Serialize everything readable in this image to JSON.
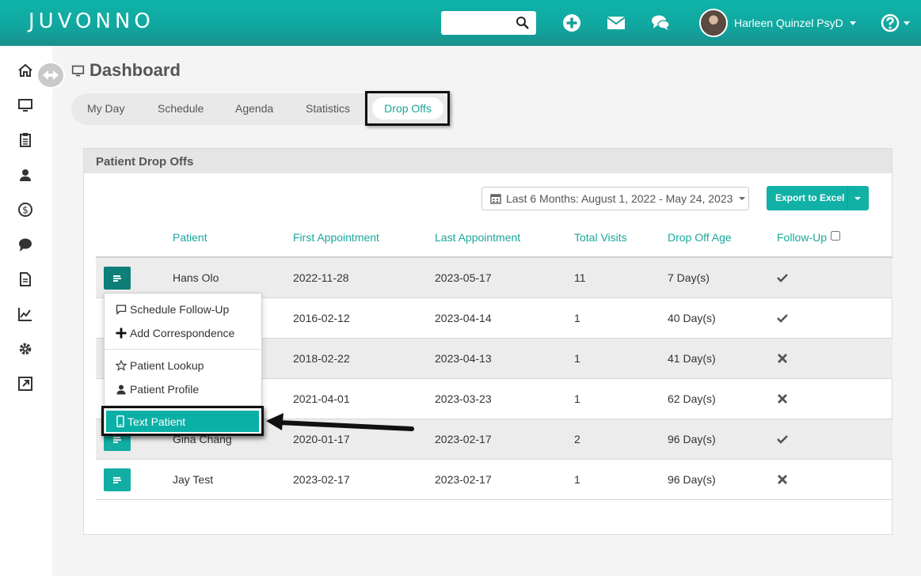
{
  "app": {
    "logo": "JUVONNO"
  },
  "header": {
    "search_placeholder": "",
    "user_name": "Harleen Quinzel PsyD"
  },
  "page": {
    "title": "Dashboard"
  },
  "tabs": [
    {
      "label": "My Day"
    },
    {
      "label": "Schedule"
    },
    {
      "label": "Agenda"
    },
    {
      "label": "Statistics"
    },
    {
      "label": "Drop Offs",
      "active": true
    }
  ],
  "panel": {
    "title": "Patient Drop Offs",
    "date_range": "Last 6 Months: August 1, 2022 - May 24, 2023",
    "export_label": "Export to Excel"
  },
  "table": {
    "columns": [
      "Patient",
      "First Appointment",
      "Last Appointment",
      "Total Visits",
      "Drop Off Age",
      "Follow-Up"
    ],
    "rows": [
      {
        "patient": "Hans Olo",
        "first": "2022-11-28",
        "last": "2023-05-17",
        "visits": "11",
        "age": "7 Day(s)",
        "follow_up": "check"
      },
      {
        "patient": "",
        "first": "2016-02-12",
        "last": "2023-04-14",
        "visits": "1",
        "age": "40 Day(s)",
        "follow_up": "check"
      },
      {
        "patient": "",
        "first": "2018-02-22",
        "last": "2023-04-13",
        "visits": "1",
        "age": "41 Day(s)",
        "follow_up": "x"
      },
      {
        "patient": "",
        "first": "2021-04-01",
        "last": "2023-03-23",
        "visits": "1",
        "age": "62 Day(s)",
        "follow_up": "x"
      },
      {
        "patient": "Gina Chang",
        "first": "2020-01-17",
        "last": "2023-02-17",
        "visits": "2",
        "age": "96 Day(s)",
        "follow_up": "check"
      },
      {
        "patient": "Jay Test",
        "first": "2023-02-17",
        "last": "2023-02-17",
        "visits": "1",
        "age": "96 Day(s)",
        "follow_up": "x"
      }
    ]
  },
  "dropdown": {
    "items": [
      "Schedule Follow-Up",
      "Add Correspondence",
      "Patient Lookup",
      "Patient Profile",
      "Text Patient"
    ],
    "highlighted": "Text Patient"
  },
  "colors": {
    "brand": "#11b1a6",
    "brand_dark": "#0d7f78",
    "header_gradient_end": "#1a8f8c"
  }
}
